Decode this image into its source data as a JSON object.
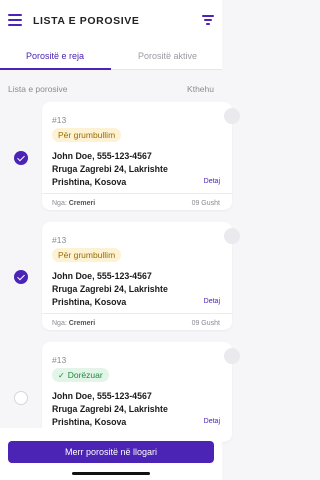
{
  "header": {
    "title": "LISTA E POROSIVE",
    "menu_icon": "hamburger-menu-icon",
    "filter_icon": "filter-icon"
  },
  "tabs": [
    {
      "label": "Porositë e reja",
      "active": true
    },
    {
      "label": "Porositë aktive",
      "active": false
    }
  ],
  "list_header": {
    "left": "Lista e porosive",
    "right": "Kthehu"
  },
  "orders": [
    {
      "selected": true,
      "number": "#13",
      "status": "Për grumbullim",
      "status_kind": "pending",
      "contact": "John Doe, 555-123-4567",
      "street": "Rruga Zagrebi 24, Lakrishte",
      "city": "Prishtina, Kosova",
      "details": "Detaj",
      "from_label": "Nga:",
      "from_name": "Cremeri",
      "date": "09 Gusht"
    },
    {
      "selected": true,
      "number": "#13",
      "status": "Për grumbullim",
      "status_kind": "pending",
      "contact": "John Doe, 555-123-4567",
      "street": "Rruga Zagrebi 24, Lakrishte",
      "city": "Prishtina, Kosova",
      "details": "Detaj",
      "from_label": "Nga:",
      "from_name": "Cremeri",
      "date": "09 Gusht"
    },
    {
      "selected": false,
      "number": "#13",
      "status": "Dorëzuar",
      "status_kind": "done",
      "contact": "John Doe, 555-123-4567",
      "street": "Rruga Zagrebi 24, Lakrishte",
      "city": "Prishtina, Kosova",
      "details": "Detaj"
    }
  ],
  "bottom": {
    "button_label": "Merr porositë në llogari"
  },
  "colors": {
    "primary": "#4b23b5",
    "pending_bg": "#fdf3d4",
    "pending_text": "#9a6a05",
    "done_bg": "#e3f4e8",
    "done_text": "#1f8a3c"
  }
}
